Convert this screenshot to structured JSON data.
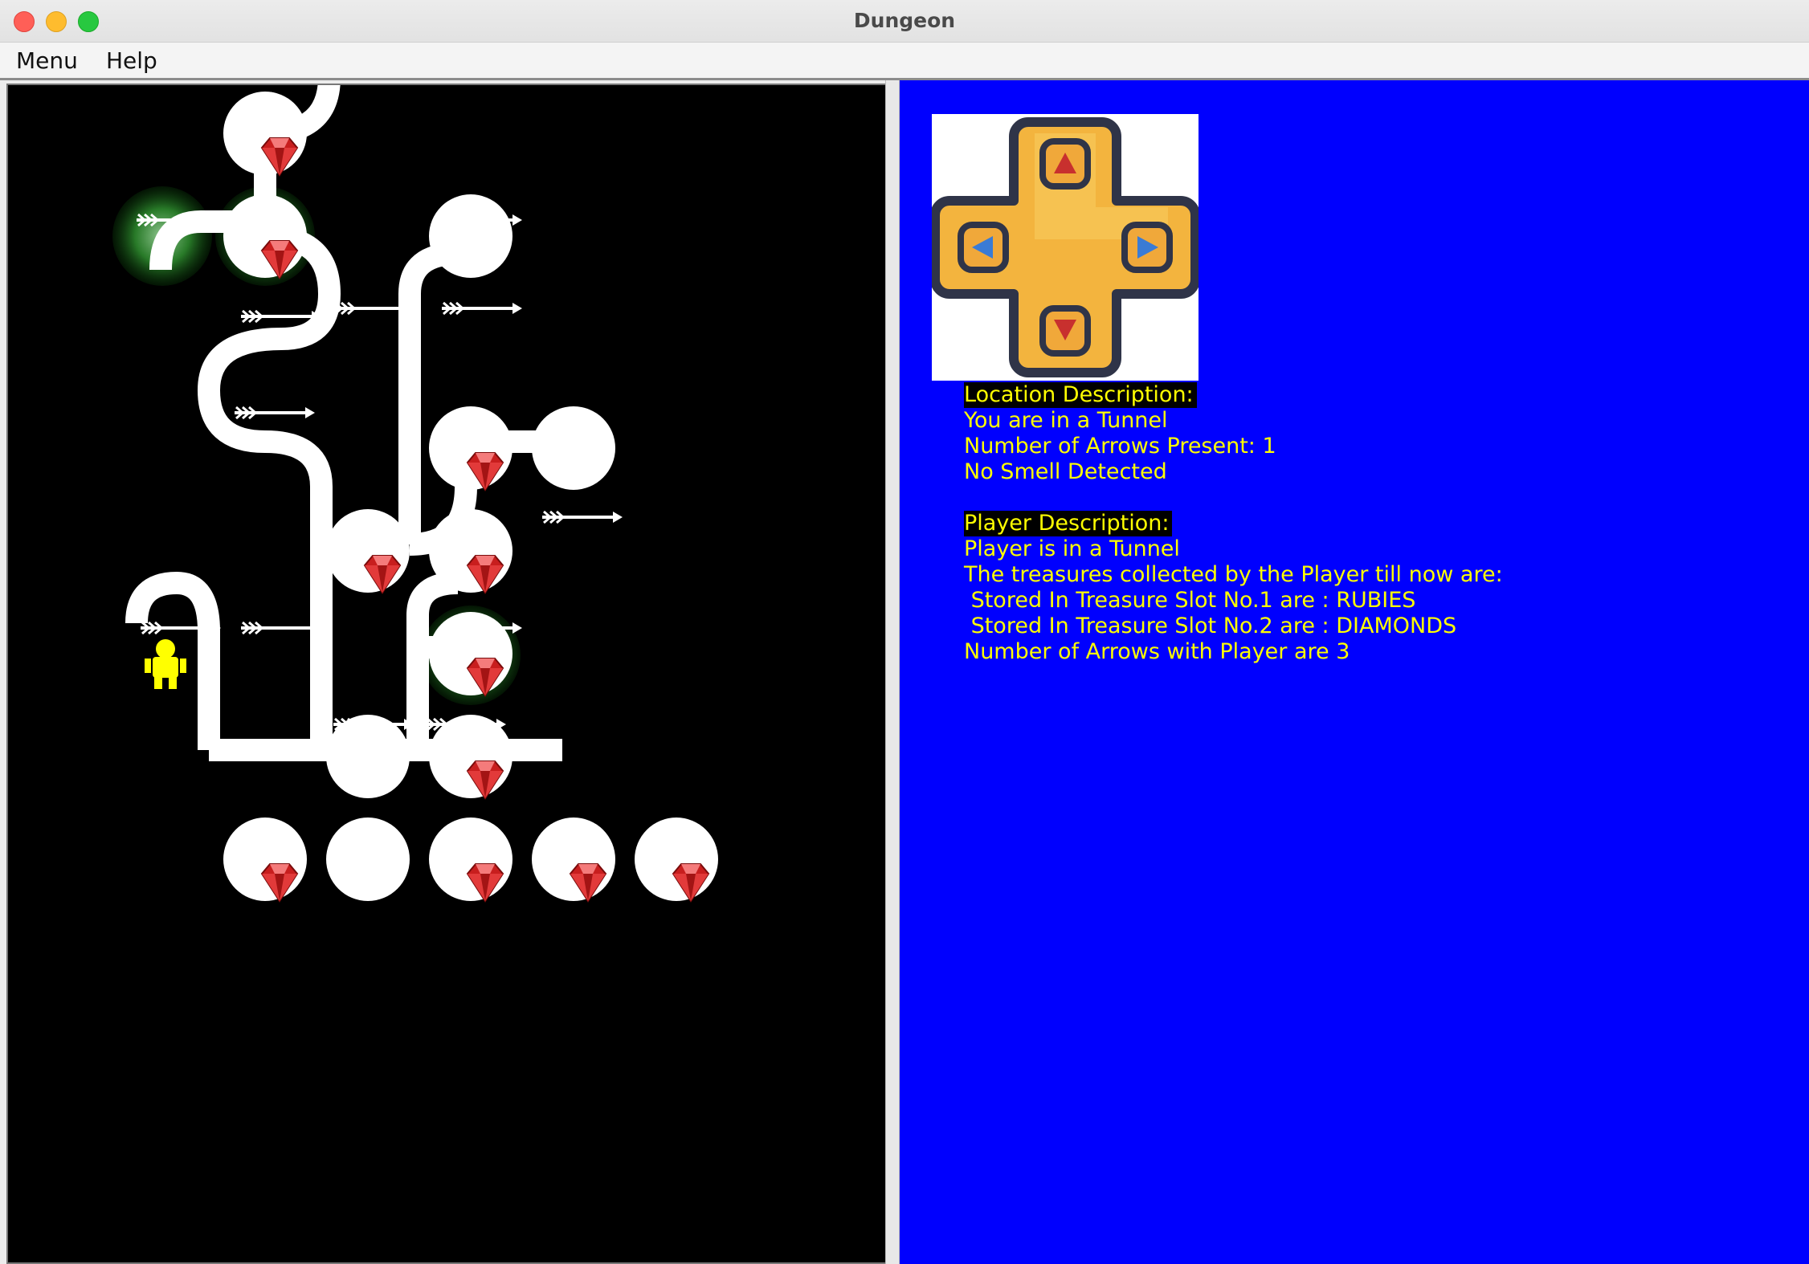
{
  "window": {
    "title": "Dungeon"
  },
  "menubar": {
    "items": [
      "Menu",
      "Help"
    ]
  },
  "location": {
    "heading": "Location Description:",
    "lines": [
      "You are in a Tunnel",
      "Number of Arrows Present: 1",
      "No Smell Detected"
    ]
  },
  "player": {
    "heading": "Player Description:",
    "lines": [
      "Player is in a Tunnel",
      "The treasures collected by the Player till now are:",
      " Stored In Treasure Slot No.1 are : RUBIES",
      " Stored In Treasure Slot No.2 are : DIAMONDS",
      "Number of Arrows with Player are 3"
    ]
  },
  "colors": {
    "map_background": "#000000",
    "info_background": "#0000fe",
    "info_text": "#ffff00",
    "path": "#ffffff",
    "gem": "#d32020",
    "smell": "#2f8f2f",
    "player": "#ffff00",
    "dpad_fill": "#f3b43e",
    "dpad_outline": "#2f3448"
  },
  "icons": [
    "dpad-icon",
    "gem-icon",
    "arrow-icon",
    "player-icon",
    "smell-icon"
  ]
}
